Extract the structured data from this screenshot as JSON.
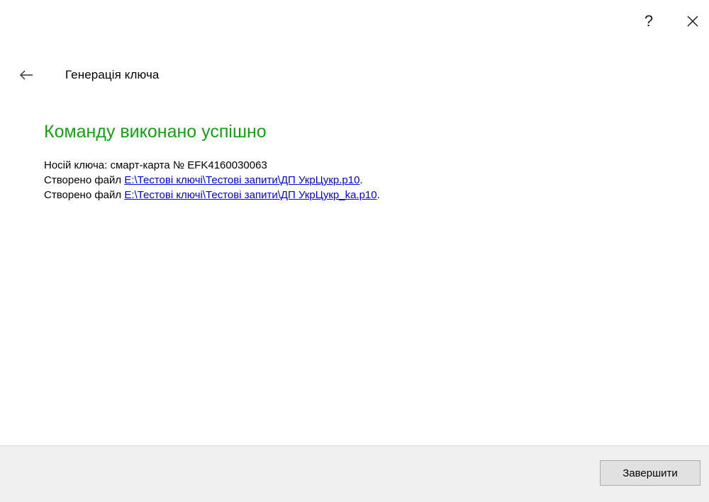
{
  "window": {
    "help_label": "?",
    "close_icon": "close-icon"
  },
  "header": {
    "back_icon": "arrow-left-icon",
    "title": "Генерація ключа"
  },
  "main": {
    "success_title": "Командy виконано успішно",
    "key_carrier_line": "Носій ключа: смарт-карта № EFK4160030063",
    "files": [
      {
        "prefix": "Створено файл ",
        "path": "E:\\Тестові ключі\\Тестові запити\\ДП УкрЦукр.p10",
        "suffix": "."
      },
      {
        "prefix": "Створено файл ",
        "path": "E:\\Тестові ключі\\Тестові запити\\ДП УкрЦукр_ka.p10",
        "suffix": "."
      }
    ]
  },
  "footer": {
    "finish_label": "Завершити"
  },
  "colors": {
    "success": "#12a312",
    "link": "#0000ee",
    "footer_bg": "#f0f0f0"
  }
}
